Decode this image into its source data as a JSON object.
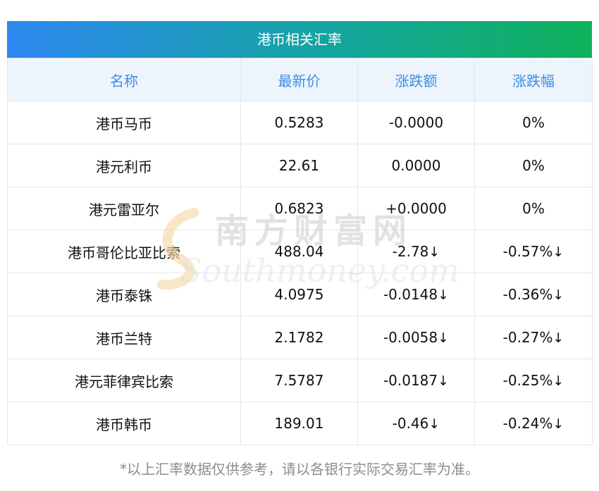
{
  "title": "港币相关汇率",
  "headers": [
    "名称",
    "最新价",
    "涨跌额",
    "涨跌幅"
  ],
  "rows": [
    {
      "name": "港币马币",
      "price": "0.5283",
      "change": "-0.0000",
      "pct": "0%",
      "trend": "flat"
    },
    {
      "name": "港元利币",
      "price": "22.61",
      "change": "0.0000",
      "pct": "0%",
      "trend": "flat"
    },
    {
      "name": "港元雷亚尔",
      "price": "0.6823",
      "change": "+0.0000",
      "pct": "0%",
      "trend": "flat"
    },
    {
      "name": "港币哥伦比亚比索",
      "price": "488.04",
      "change": "-2.78",
      "pct": "-0.57",
      "trend": "down"
    },
    {
      "name": "港币泰铢",
      "price": "4.0975",
      "change": "-0.0148",
      "pct": "-0.36",
      "trend": "down"
    },
    {
      "name": "港币兰特",
      "price": "2.1782",
      "change": "-0.0058",
      "pct": "-0.27",
      "trend": "down"
    },
    {
      "name": "港元菲律宾比索",
      "price": "7.5787",
      "change": "-0.0187",
      "pct": "-0.25",
      "trend": "down"
    },
    {
      "name": "港币韩币",
      "price": "189.01",
      "change": "-0.46",
      "pct": "-0.24",
      "trend": "down"
    }
  ],
  "down_arrow": "↓",
  "footnote": "*以上汇率数据仅供参考，请以各银行实际交易汇率为准。",
  "watermark": {
    "cn": "南方财富网",
    "en": "Southmoney.com"
  },
  "colors": {
    "down": "#1a8a1a",
    "header_text": "#3b8de6",
    "header_bg": "#eef4fc"
  }
}
